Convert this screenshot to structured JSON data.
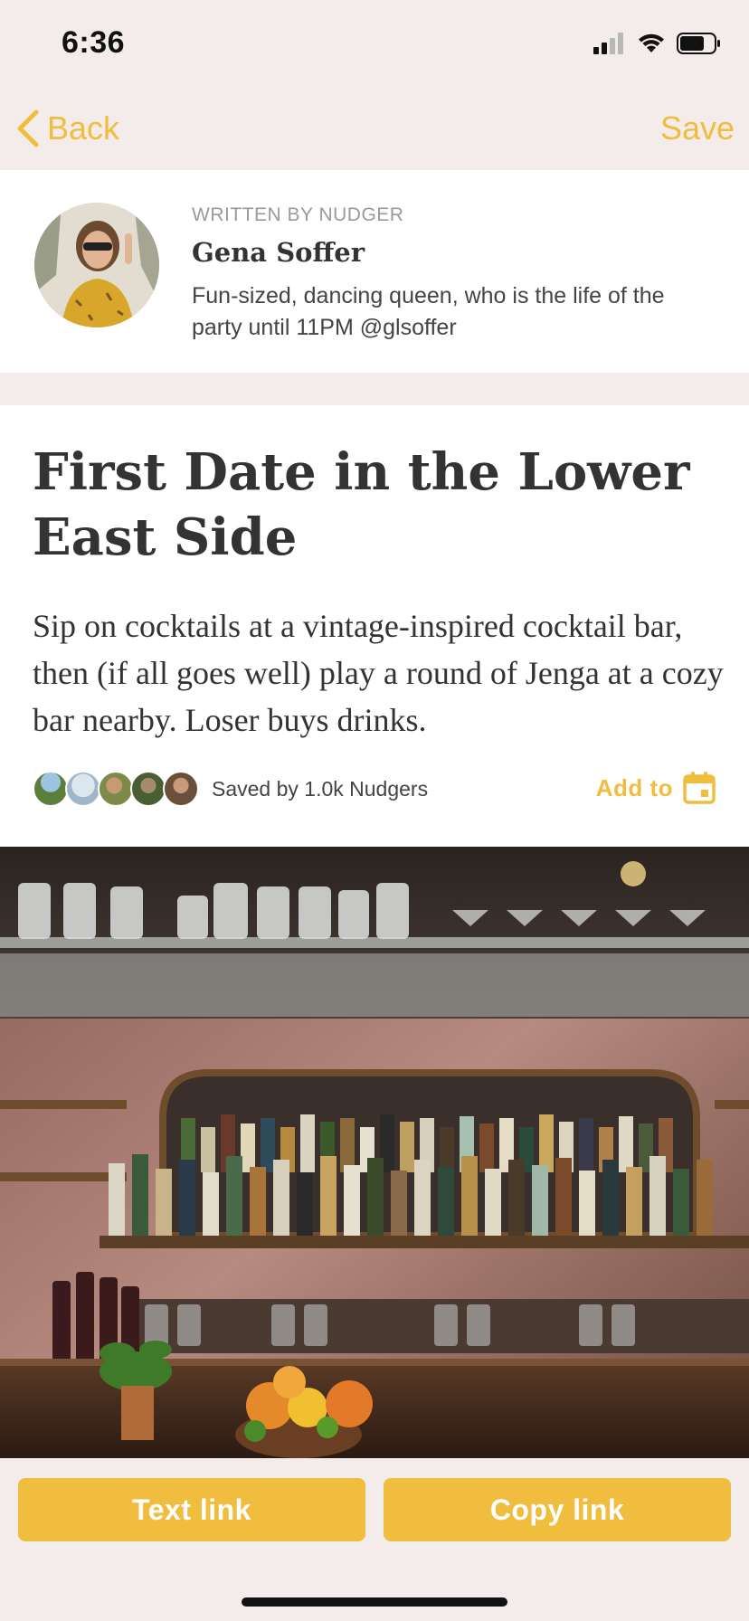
{
  "status_bar": {
    "time": "6:36",
    "icons": [
      "cellular-signal-icon",
      "wifi-icon",
      "battery-icon"
    ]
  },
  "nav": {
    "back_label": "Back",
    "save_label": "Save",
    "accent_color": "#f0bd3f"
  },
  "author": {
    "eyebrow": "WRITTEN BY NUDGER",
    "name": "Gena  Soffer",
    "bio": "Fun-sized, dancing queen, who is the life of the party until 11PM @glsoffer"
  },
  "article": {
    "title": "First Date in the Lower East Side",
    "description": "Sip on cocktails at a vintage-inspired cocktail bar, then (if all goes well) play a round of Jenga at a cozy bar nearby. Loser buys drinks.",
    "saved_by": "Saved by 1.0k Nudgers",
    "add_to_label": "Add to"
  },
  "actions": {
    "text_link_label": "Text link",
    "copy_link_label": "Copy link"
  }
}
